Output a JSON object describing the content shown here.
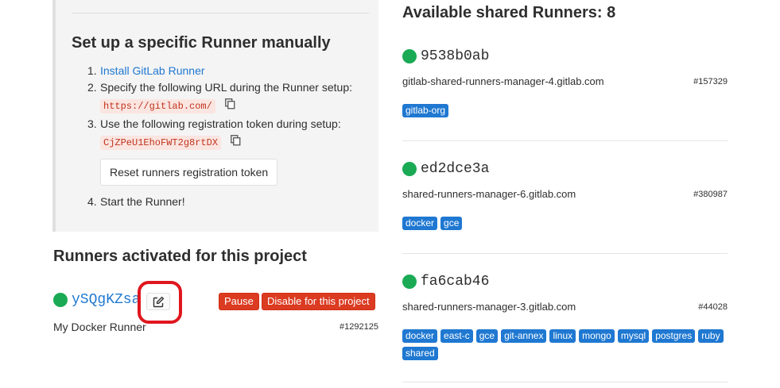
{
  "setup": {
    "title": "Set up a specific Runner manually",
    "step1_link": "Install GitLab Runner",
    "step2_text": "Specify the following URL during the Runner setup:",
    "url": "https://gitlab.com/",
    "step3_text": "Use the following registration token during setup:",
    "token": "CjZPeU1EhoFWT2g8rtDX",
    "reset_button": "Reset runners registration token",
    "step4_text": "Start the Runner!"
  },
  "activated": {
    "title": "Runners activated for this project",
    "runner": {
      "id": "ySQgKZsa",
      "status_color": "#1aaa55",
      "pause_label": "Pause",
      "disable_label": "Disable for this project",
      "description": "My Docker Runner",
      "number": "#1292125"
    }
  },
  "shared": {
    "title": "Available shared Runners: 8",
    "runners": [
      {
        "id": "9538b0ab",
        "description": "gitlab-shared-runners-manager-4.gitlab.com",
        "number": "#157329",
        "tags": [
          "gitlab-org"
        ]
      },
      {
        "id": "ed2dce3a",
        "description": "shared-runners-manager-6.gitlab.com",
        "number": "#380987",
        "tags": [
          "docker",
          "gce"
        ]
      },
      {
        "id": "fa6cab46",
        "description": "shared-runners-manager-3.gitlab.com",
        "number": "#44028",
        "tags": [
          "docker",
          "east-c",
          "gce",
          "git-annex",
          "linux",
          "mongo",
          "mysql",
          "postgres",
          "ruby",
          "shared"
        ]
      }
    ]
  },
  "icons": {
    "copy": "copy-to-clipboard-icon",
    "edit": "pencil-square-icon",
    "status": "status-dot-icon"
  },
  "colors": {
    "link": "#1f78d1",
    "danger": "#db3b21",
    "tag": "#1f78d1",
    "online": "#1aaa55",
    "highlight": "#e0161e"
  }
}
